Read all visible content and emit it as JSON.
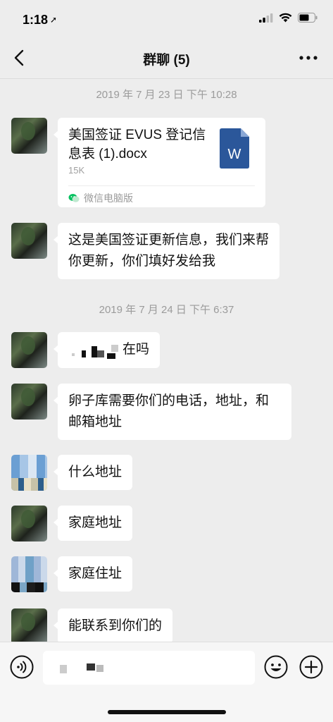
{
  "status_bar": {
    "time": "1:18",
    "location_icon": "location-arrow-icon",
    "signal_icon": "cellular-signal-icon",
    "wifi_icon": "wifi-icon",
    "battery_icon": "battery-icon"
  },
  "header": {
    "back_icon": "chevron-left-icon",
    "title": "群聊 (5)",
    "more_icon": "ellipsis-icon"
  },
  "messages": {
    "timestamp_1": "2019 年 7 月 23 日 下午 10:28",
    "file": {
      "name": "美国签证 EVUS 登记信息表 (1).docx",
      "size": "15K",
      "source": "微信电脑版",
      "icon": "word-document-icon",
      "icon_letter": "W",
      "icon_color": "#2b579a"
    },
    "text_1": "这是美国签证更新信息，我们来帮你更新，你们填好发给我",
    "timestamp_2": "2019 年 7 月 24 日 下午 6:37",
    "text_2_visible": "在吗",
    "text_3": "卵子库需要你们的电话，地址，和邮箱地址",
    "text_4": "什么地址",
    "text_5": "家庭地址",
    "text_6": "家庭住址",
    "text_7": "能联系到你们的"
  },
  "input_bar": {
    "voice_icon": "voice-icon",
    "emoji_icon": "emoji-icon",
    "add_icon": "plus-circle-icon"
  },
  "colors": {
    "background": "#ededed",
    "bubble": "#ffffff",
    "timestamp": "#9b9b9b",
    "wechat_green": "#07c160"
  }
}
